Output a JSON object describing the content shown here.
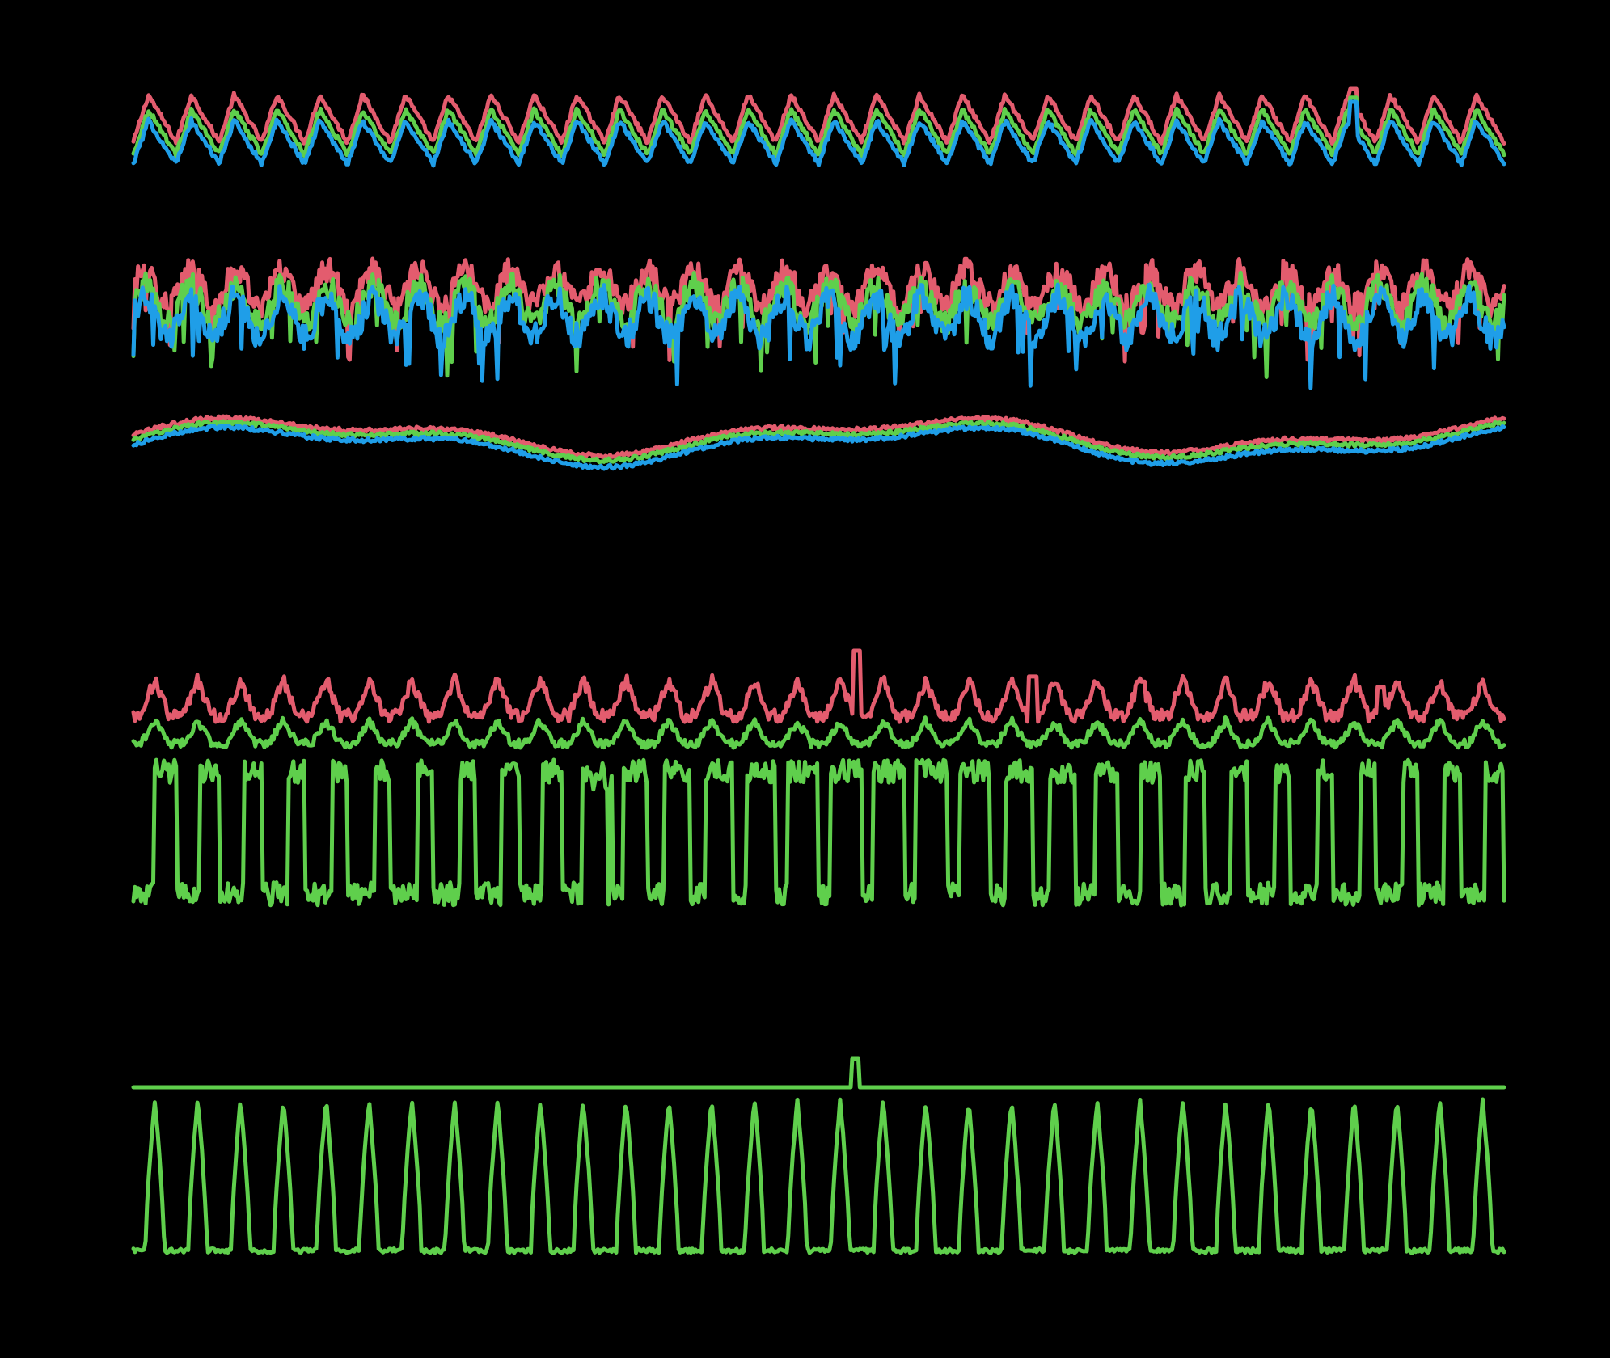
{
  "colors": {
    "background": "#000000",
    "red": "#e35c6e",
    "green": "#5fcf4c",
    "blue": "#1f9ee8"
  },
  "chart_data": {
    "type": "line",
    "title": "",
    "xlabel": "",
    "ylabel": "",
    "axes_visible": false,
    "grid": false,
    "legend": "none",
    "x_range": [
      0,
      1
    ],
    "panels": [
      {
        "id": "panel-1",
        "series": [
          {
            "color": "red",
            "kind": "periodic",
            "cycles": 32,
            "base": 0.3,
            "amp": 0.55,
            "shape": "saw",
            "noise": 0.06,
            "spikes": [
              {
                "x": 0.89,
                "v": 1.0
              }
            ],
            "offset": 0.08
          },
          {
            "color": "green",
            "kind": "periodic",
            "cycles": 32,
            "base": 0.24,
            "amp": 0.52,
            "shape": "saw",
            "noise": 0.06,
            "spikes": [
              {
                "x": 0.89,
                "v": 0.9
              }
            ],
            "offset": 0.0
          },
          {
            "color": "blue",
            "kind": "periodic",
            "cycles": 32,
            "base": 0.18,
            "amp": 0.5,
            "shape": "saw",
            "noise": 0.06,
            "spikes": [
              {
                "x": 0.89,
                "v": 0.85
              }
            ],
            "offset": -0.05
          }
        ]
      },
      {
        "id": "panel-2",
        "series": [
          {
            "color": "red",
            "kind": "noisy",
            "cycles": 30,
            "base": 0.7,
            "amp": 0.35,
            "noise": 0.25,
            "offset": 0.08
          },
          {
            "color": "green",
            "kind": "noisy",
            "cycles": 30,
            "base": 0.62,
            "amp": 0.38,
            "noise": 0.25,
            "offset": 0.0
          },
          {
            "color": "blue",
            "kind": "noisy",
            "cycles": 30,
            "base": 0.55,
            "amp": 0.4,
            "noise": 0.27,
            "offset": -0.06
          }
        ]
      },
      {
        "id": "panel-3",
        "series": [
          {
            "color": "red",
            "kind": "slow",
            "base": 0.55,
            "amp": 0.35,
            "noise": 0.05,
            "offset": 0.03
          },
          {
            "color": "green",
            "kind": "slow",
            "base": 0.52,
            "amp": 0.35,
            "noise": 0.05,
            "offset": 0.0
          },
          {
            "color": "blue",
            "kind": "slow",
            "base": 0.48,
            "amp": 0.37,
            "noise": 0.05,
            "offset": -0.03
          }
        ]
      },
      {
        "id": "panel-4",
        "series": [
          {
            "color": "red",
            "kind": "periodic",
            "cycles": 32,
            "base": 0.25,
            "amp": 0.35,
            "shape": "spiky",
            "noise": 0.12,
            "spikes": [
              {
                "x": 0.528,
                "v": 1.0
              },
              {
                "x": 0.656,
                "v": 0.75
              },
              {
                "x": 0.735,
                "v": 0.7
              },
              {
                "x": 0.91,
                "v": 0.65
              }
            ],
            "offset": 0.12
          },
          {
            "color": "green",
            "kind": "periodic",
            "cycles": 32,
            "base": 0.1,
            "amp": 0.22,
            "shape": "spiky",
            "noise": 0.08,
            "offset": 0.0
          }
        ]
      },
      {
        "id": "panel-5",
        "series": [
          {
            "color": "green",
            "kind": "square",
            "cycles": 32,
            "base": 0.1,
            "amp": 0.8,
            "noise": 0.15,
            "offset": 0.0
          }
        ]
      },
      {
        "id": "panel-6",
        "series": [
          {
            "color": "green",
            "kind": "flat",
            "base": 0.5,
            "noise": 0.0,
            "spikes": [
              {
                "x": 0.527,
                "v": 1.0
              }
            ],
            "offset": 0.0
          }
        ]
      },
      {
        "id": "panel-7",
        "series": [
          {
            "color": "green",
            "kind": "pulse",
            "cycles": 32,
            "base": 0.0,
            "amp": 1.0,
            "noise": 0.03,
            "offset": 0.0
          }
        ]
      }
    ]
  }
}
